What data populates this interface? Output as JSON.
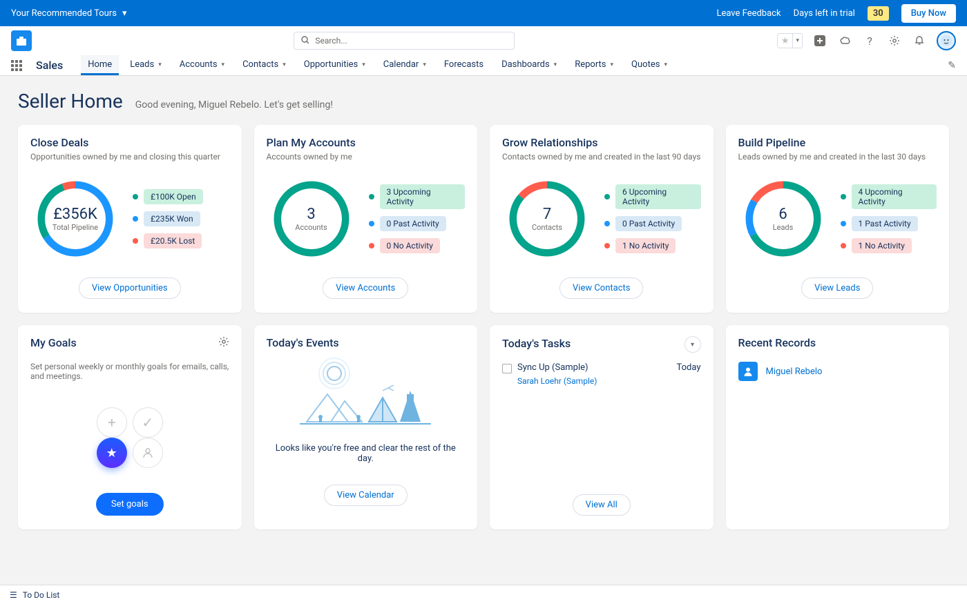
{
  "topbar": {
    "tours": "Your Recommended Tours",
    "feedback": "Leave Feedback",
    "trial_text": "Days left in trial",
    "trial_days": "30",
    "buy": "Buy Now"
  },
  "search": {
    "placeholder": "Search..."
  },
  "app_name": "Sales",
  "tabs": [
    "Home",
    "Leads",
    "Accounts",
    "Contacts",
    "Opportunities",
    "Calendar",
    "Forecasts",
    "Dashboards",
    "Reports",
    "Quotes"
  ],
  "page": {
    "title": "Seller Home",
    "greeting": "Good evening, Miguel Rebelo. Let's get selling!"
  },
  "cards": {
    "close_deals": {
      "title": "Close Deals",
      "sub": "Opportunities owned by me and closing this quarter",
      "center_big": "£356K",
      "center_small": "Total Pipeline",
      "legend": [
        {
          "dot": "#04a38b",
          "pill": "pill-green",
          "label": "£100K Open"
        },
        {
          "dot": "#1b96ff",
          "pill": "pill-blue",
          "label": "£235K Won"
        },
        {
          "dot": "#fe5c4c",
          "pill": "pill-red",
          "label": "£20.5K Lost"
        }
      ],
      "btn": "View Opportunities"
    },
    "plan_accounts": {
      "title": "Plan My Accounts",
      "sub": "Accounts owned by me",
      "center_big": "3",
      "center_small": "Accounts",
      "legend": [
        {
          "dot": "#04a38b",
          "pill": "pill-green",
          "label": "3 Upcoming Activity"
        },
        {
          "dot": "#1b96ff",
          "pill": "pill-blue",
          "label": "0 Past Activity"
        },
        {
          "dot": "#fe5c4c",
          "pill": "pill-red",
          "label": "0 No Activity"
        }
      ],
      "btn": "View Accounts"
    },
    "grow": {
      "title": "Grow Relationships",
      "sub": "Contacts owned by me and created in the last 90 days",
      "center_big": "7",
      "center_small": "Contacts",
      "legend": [
        {
          "dot": "#04a38b",
          "pill": "pill-green",
          "label": "6 Upcoming Activity"
        },
        {
          "dot": "#1b96ff",
          "pill": "pill-blue",
          "label": "0 Past Activity"
        },
        {
          "dot": "#fe5c4c",
          "pill": "pill-red",
          "label": "1 No Activity"
        }
      ],
      "btn": "View Contacts"
    },
    "pipeline": {
      "title": "Build Pipeline",
      "sub": "Leads owned by me and created in the last 30 days",
      "center_big": "6",
      "center_small": "Leads",
      "legend": [
        {
          "dot": "#04a38b",
          "pill": "pill-green",
          "label": "4 Upcoming Activity"
        },
        {
          "dot": "#1b96ff",
          "pill": "pill-blue",
          "label": "1 Past Activity"
        },
        {
          "dot": "#fe5c4c",
          "pill": "pill-red",
          "label": "1 No Activity"
        }
      ],
      "btn": "View Leads"
    },
    "goals": {
      "title": "My Goals",
      "sub": "Set personal weekly or monthly goals for emails, calls, and meetings.",
      "btn": "Set goals"
    },
    "events": {
      "title": "Today's Events",
      "text": "Looks like you're free and clear the rest of the day.",
      "btn": "View Calendar"
    },
    "tasks": {
      "title": "Today's Tasks",
      "items": [
        {
          "label": "Sync Up (Sample)",
          "link": "Sarah Loehr (Sample)",
          "when": "Today"
        }
      ],
      "btn": "View All"
    },
    "recent": {
      "title": "Recent Records",
      "items": [
        {
          "label": "Miguel Rebelo"
        }
      ]
    }
  },
  "footer": {
    "todo": "To Do List"
  },
  "chart_data": [
    {
      "type": "pie",
      "title": "Close Deals",
      "series": [
        {
          "name": "Open",
          "value": 100
        },
        {
          "name": "Won",
          "value": 235
        },
        {
          "name": "Lost",
          "value": 20.5
        }
      ],
      "unit": "£K",
      "total_label": "Total Pipeline",
      "total": "£356K"
    },
    {
      "type": "pie",
      "title": "Plan My Accounts",
      "series": [
        {
          "name": "Upcoming Activity",
          "value": 3
        },
        {
          "name": "Past Activity",
          "value": 0
        },
        {
          "name": "No Activity",
          "value": 0
        }
      ],
      "total_label": "Accounts",
      "total": 3
    },
    {
      "type": "pie",
      "title": "Grow Relationships",
      "series": [
        {
          "name": "Upcoming Activity",
          "value": 6
        },
        {
          "name": "Past Activity",
          "value": 0
        },
        {
          "name": "No Activity",
          "value": 1
        }
      ],
      "total_label": "Contacts",
      "total": 7
    },
    {
      "type": "pie",
      "title": "Build Pipeline",
      "series": [
        {
          "name": "Upcoming Activity",
          "value": 4
        },
        {
          "name": "Past Activity",
          "value": 1
        },
        {
          "name": "No Activity",
          "value": 1
        }
      ],
      "total_label": "Leads",
      "total": 6
    }
  ]
}
